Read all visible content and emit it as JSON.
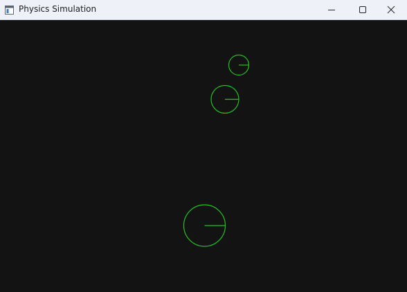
{
  "window": {
    "title": "Physics Simulation",
    "controls": {
      "minimize_icon": "minimize-icon",
      "maximize_icon": "maximize-icon",
      "close_icon": "close-icon"
    }
  },
  "simulation": {
    "background_color": "#131313",
    "ball_color": "#22c322"
  }
}
